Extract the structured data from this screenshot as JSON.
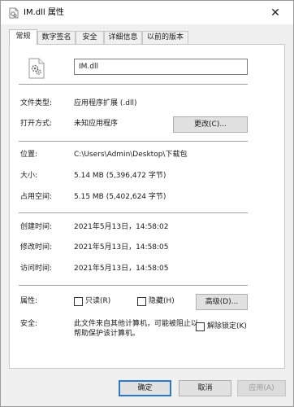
{
  "window": {
    "title": "IM.dll 属性"
  },
  "tabs": [
    {
      "label": "常规"
    },
    {
      "label": "数字签名"
    },
    {
      "label": "安全"
    },
    {
      "label": "详细信息"
    },
    {
      "label": "以前的版本"
    }
  ],
  "general": {
    "file_name": "IM.dll",
    "file_type_label": "文件类型:",
    "file_type_value": "应用程序扩展 (.dll)",
    "open_with_label": "打开方式:",
    "open_with_value": "未知应用程序",
    "change_button": "更改(C)...",
    "location_label": "位置:",
    "location_value": "C:\\Users\\Admin\\Desktop\\下载包",
    "size_label": "大小:",
    "size_value": "5.14 MB (5,396,472 字节)",
    "size_on_disk_label": "占用空间:",
    "size_on_disk_value": "5.15 MB (5,402,624 字节)",
    "created_label": "创建时间:",
    "created_value": "2021年5月13日，14:58:02",
    "modified_label": "修改时间:",
    "modified_value": "2021年5月13日，14:58:05",
    "accessed_label": "访问时间:",
    "accessed_value": "2021年5月13日，14:58:05",
    "attributes_label": "属性:",
    "readonly_label": "只读(R)",
    "hidden_label": "隐藏(H)",
    "advanced_button": "高级(D)...",
    "security_label": "安全:",
    "security_text": "此文件来自其他计算机，可能被阻止以帮助保护该计算机。",
    "unblock_label": "解除锁定(K)"
  },
  "footer": {
    "ok": "确定",
    "cancel": "取消",
    "apply": "应用(A)"
  },
  "colors": {
    "accent": "#2b78c6",
    "window_bg": "#f0f0f0",
    "panel_bg": "#ffffff"
  }
}
